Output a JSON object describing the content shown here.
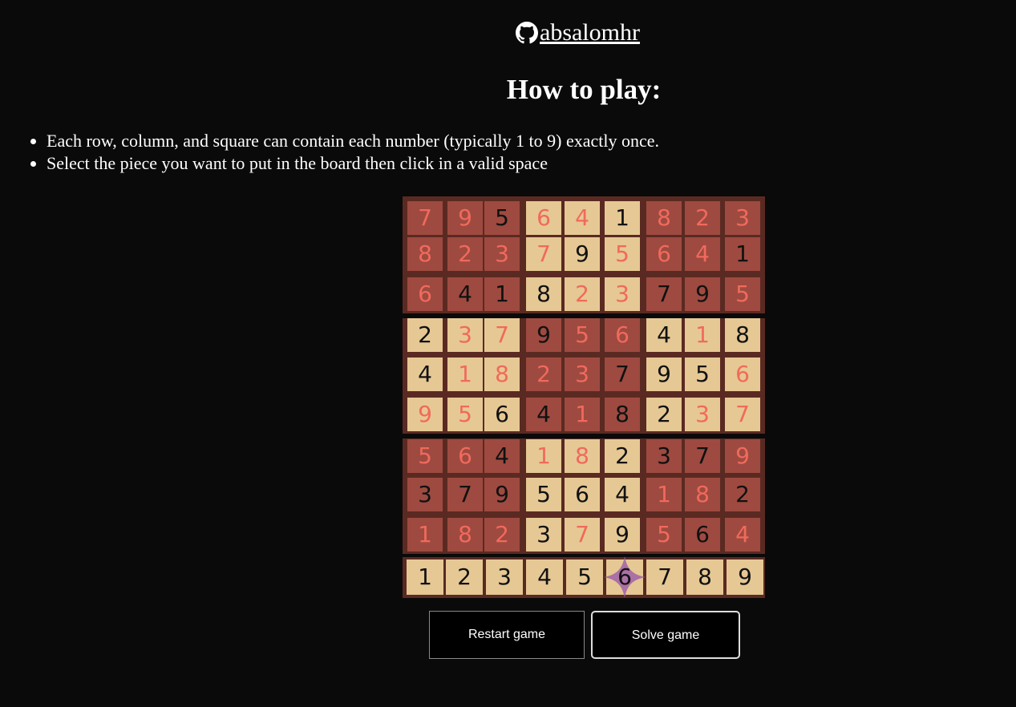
{
  "header": {
    "username": " absalomhr",
    "icon": "github-icon"
  },
  "title": "How to play:",
  "rules": [
    "Each row, column, and square can contain each number (typically 1 to 9) exactly once.",
    "Select the piece you want to put in the board then click in a valid space"
  ],
  "board": {
    "rows": [
      [
        "7",
        "9",
        "5",
        "6",
        "4",
        "1",
        "8",
        "2",
        "3"
      ],
      [
        "8",
        "2",
        "3",
        "7",
        "9",
        "5",
        "6",
        "4",
        "1"
      ],
      [
        "6",
        "4",
        "1",
        "8",
        "2",
        "3",
        "7",
        "9",
        "5"
      ],
      [
        "2",
        "3",
        "7",
        "9",
        "5",
        "6",
        "4",
        "1",
        "8"
      ],
      [
        "4",
        "1",
        "8",
        "2",
        "3",
        "7",
        "9",
        "5",
        "6"
      ],
      [
        "9",
        "5",
        "6",
        "4",
        "1",
        "8",
        "2",
        "3",
        "7"
      ],
      [
        "5",
        "6",
        "4",
        "1",
        "8",
        "2",
        "3",
        "7",
        "9"
      ],
      [
        "3",
        "7",
        "9",
        "5",
        "6",
        "4",
        "1",
        "8",
        "2"
      ],
      [
        "1",
        "8",
        "2",
        "3",
        "7",
        "9",
        "5",
        "6",
        "4"
      ]
    ],
    "red_mask": [
      [
        1,
        1,
        0,
        1,
        1,
        0,
        1,
        1,
        1
      ],
      [
        1,
        1,
        1,
        1,
        0,
        1,
        1,
        1,
        0
      ],
      [
        1,
        0,
        0,
        0,
        1,
        1,
        0,
        0,
        1
      ],
      [
        0,
        1,
        1,
        0,
        1,
        1,
        0,
        1,
        0
      ],
      [
        0,
        1,
        1,
        1,
        1,
        0,
        0,
        0,
        1
      ],
      [
        1,
        1,
        0,
        0,
        1,
        0,
        0,
        1,
        1
      ],
      [
        1,
        1,
        0,
        1,
        1,
        0,
        0,
        0,
        1
      ],
      [
        0,
        0,
        0,
        0,
        0,
        0,
        1,
        1,
        0
      ],
      [
        1,
        1,
        1,
        0,
        1,
        0,
        1,
        0,
        1
      ]
    ],
    "colors": {
      "dark_box": "#9e4a40",
      "light_box": "#e6c894",
      "red_digit": "#f06a5c",
      "black_digit": "#111111",
      "board_border": "#5a2a22",
      "selected_marker": "#a060a8"
    }
  },
  "pieces": [
    "1",
    "2",
    "3",
    "4",
    "5",
    "6",
    "7",
    "8",
    "9"
  ],
  "selected_piece": "6",
  "buttons": {
    "restart": "Restart game",
    "solve": "Solve game"
  }
}
